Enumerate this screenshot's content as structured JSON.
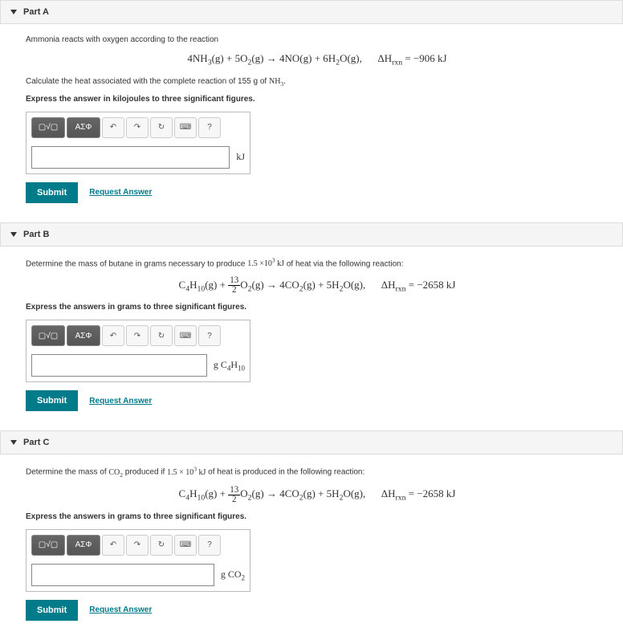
{
  "partA": {
    "title": "Part A",
    "intro": "Ammonia reacts with oxygen according to the reaction",
    "calc_line_prefix": "Calculate the heat associated with the complete reaction of 155 g of ",
    "calc_line_species": "NH3",
    "bold": "Express the answer in kilojoules to three significant figures.",
    "unit": "kJ",
    "submit": "Submit",
    "request": "Request Answer",
    "eq": {
      "lhs1": "4NH",
      "lhs1sub": "3",
      "state1": "(g)",
      "plus": " + ",
      "lhs2": "5O",
      "lhs2sub": "2",
      "state2": "(g)",
      "arrow": " → ",
      "rhs1": "4NO(g)",
      "rhs2": "6H",
      "rhs2sub": "2",
      "rhs2tail": "O(g),",
      "dH_label": "ΔH",
      "dH_sub": "rxn",
      "dH_val": " = −906 kJ"
    }
  },
  "partB": {
    "title": "Part B",
    "intro_prefix": "Determine the mass of butane in grams necessary to produce ",
    "intro_value": "1.5 ×10",
    "intro_exp": "3",
    "intro_unit": " kJ",
    "intro_suffix": " of heat via the following reaction:",
    "bold": "Express the answers in grams to three significant figures.",
    "unit_prefix": "g ",
    "unit_species_main": "C",
    "unit_species_sub1": "4",
    "unit_species_mid": "H",
    "unit_species_sub2": "10",
    "submit": "Submit",
    "request": "Request Answer",
    "eq": {
      "lhs1a": "C",
      "lhs1sub1": "4",
      "lhs1b": "H",
      "lhs1sub2": "10",
      "state1": "(g)",
      "frac_num": "13",
      "frac_den": "2",
      "lhs2": "O",
      "lhs2sub": "2",
      "state2": "(g)",
      "rhs1a": "4CO",
      "rhs1sub": "2",
      "rhs1state": "(g)",
      "rhs2a": "5H",
      "rhs2sub": "2",
      "rhs2tail": "O(g),",
      "dH_label": "ΔH",
      "dH_sub": "rxn",
      "dH_val": " = −2658 kJ"
    }
  },
  "partC": {
    "title": "Part C",
    "intro_prefix": "Determine the mass of ",
    "intro_species_main": "CO",
    "intro_species_sub": "2",
    "intro_mid": " produced if ",
    "intro_value": "1.5 × 10",
    "intro_exp": "3",
    "intro_unit": " kJ",
    "intro_suffix": " of heat is produced in the following reaction:",
    "bold": "Express the answers in grams to three significant figures.",
    "unit_prefix": "g ",
    "unit_species_main": "CO",
    "unit_species_sub": "2",
    "submit": "Submit",
    "request": "Request Answer"
  },
  "toolbar": {
    "templates": "▢√▢",
    "greek": "ΑΣΦ",
    "undo": "↶",
    "redo": "↷",
    "reset": "↻",
    "keyboard": "⌨",
    "help": "?"
  }
}
